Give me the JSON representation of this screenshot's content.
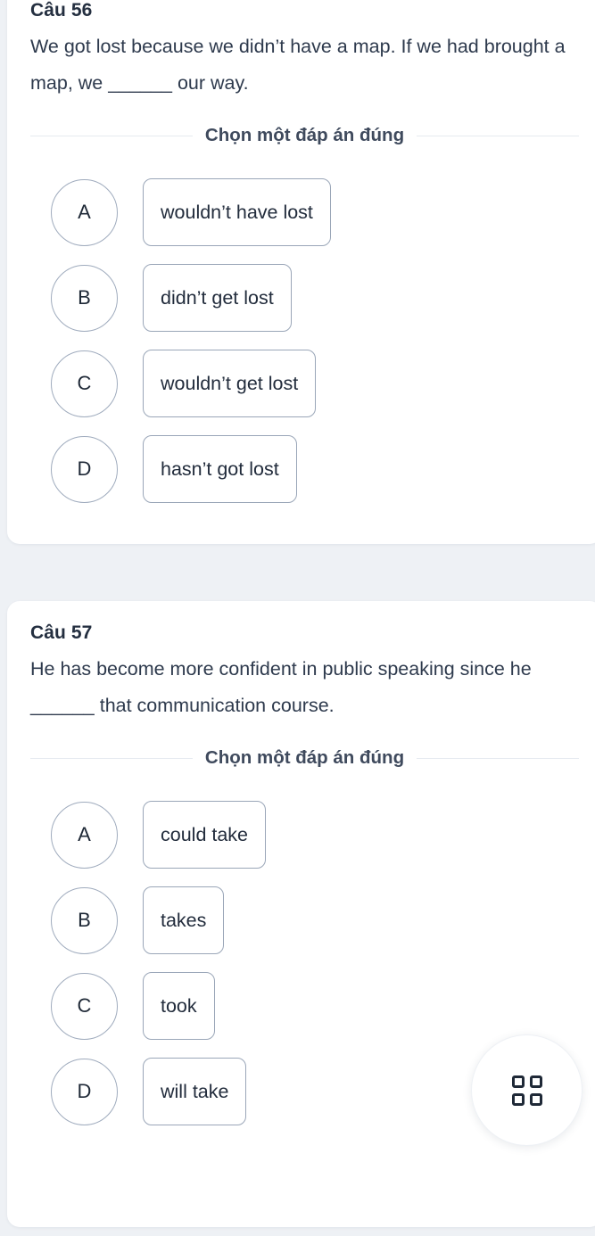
{
  "theme": {
    "page_background": "#eef1f5",
    "card_background": "#ffffff",
    "text_color": "#2e3a4d",
    "heading_color": "#242f40",
    "border_color": "#9aa6b8",
    "divider_color": "#e6eaf0",
    "icon_color": "#1f2937"
  },
  "questions": [
    {
      "number_label": "Câu 56",
      "prompt": "We got lost because we didn’t have a map. If we had brought a map, we ______ our way.",
      "instruction": "Chọn một đáp án đúng",
      "options": [
        {
          "key": "A",
          "label": "wouldn’t have lost"
        },
        {
          "key": "B",
          "label": "didn’t get lost"
        },
        {
          "key": "C",
          "label": "wouldn’t get lost"
        },
        {
          "key": "D",
          "label": "hasn’t got lost"
        }
      ]
    },
    {
      "number_label": "Câu 57",
      "prompt": "He has become more confident in public speaking since he ______ that communication course.",
      "instruction": "Chọn một đáp án đúng",
      "options": [
        {
          "key": "A",
          "label": "could take"
        },
        {
          "key": "B",
          "label": "takes"
        },
        {
          "key": "C",
          "label": "took"
        },
        {
          "key": "D",
          "label": "will take"
        }
      ]
    }
  ],
  "fab": {
    "icon": "grid-2x2-icon",
    "label": ""
  }
}
